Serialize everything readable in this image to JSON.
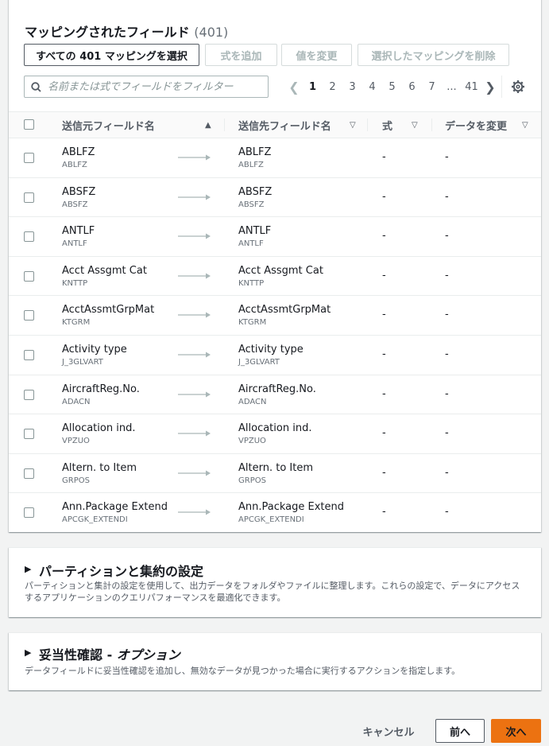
{
  "mapping": {
    "title": "マッピングされたフィールド",
    "count": "(401)",
    "buttons": {
      "select_all": "すべての 401 マッピングを選択",
      "add_formula": "式を追加",
      "change_value": "値を変更",
      "delete_selected": "選択したマッピングを削除"
    },
    "search_placeholder": "名前または式でフィールドをフィルター",
    "pagination": {
      "pages": [
        "1",
        "2",
        "3",
        "4",
        "5",
        "6",
        "7"
      ],
      "ellipsis": "...",
      "last": "41",
      "current": "1"
    },
    "columns": {
      "source": "送信元フィールド名",
      "target": "送信先フィールド名",
      "formula": "式",
      "transform": "データを変更"
    },
    "rows": [
      {
        "src_name": "ABLFZ",
        "src_code": "ABLFZ",
        "dst_name": "ABLFZ",
        "dst_code": "ABLFZ",
        "formula": "-",
        "transform": "-"
      },
      {
        "src_name": "ABSFZ",
        "src_code": "ABSFZ",
        "dst_name": "ABSFZ",
        "dst_code": "ABSFZ",
        "formula": "-",
        "transform": "-"
      },
      {
        "src_name": "ANTLF",
        "src_code": "ANTLF",
        "dst_name": "ANTLF",
        "dst_code": "ANTLF",
        "formula": "-",
        "transform": "-"
      },
      {
        "src_name": "Acct Assgmt Cat",
        "src_code": "KNTTP",
        "dst_name": "Acct Assgmt Cat",
        "dst_code": "KNTTP",
        "formula": "-",
        "transform": "-"
      },
      {
        "src_name": "AcctAssmtGrpMat",
        "src_code": "KTGRM",
        "dst_name": "AcctAssmtGrpMat",
        "dst_code": "KTGRM",
        "formula": "-",
        "transform": "-"
      },
      {
        "src_name": "Activity type",
        "src_code": "J_3GLVART",
        "dst_name": "Activity type",
        "dst_code": "J_3GLVART",
        "formula": "-",
        "transform": "-"
      },
      {
        "src_name": "AircraftReg.No.",
        "src_code": "ADACN",
        "dst_name": "AircraftReg.No.",
        "dst_code": "ADACN",
        "formula": "-",
        "transform": "-"
      },
      {
        "src_name": "Allocation ind.",
        "src_code": "VPZUO",
        "dst_name": "Allocation ind.",
        "dst_code": "VPZUO",
        "formula": "-",
        "transform": "-"
      },
      {
        "src_name": "Altern. to Item",
        "src_code": "GRPOS",
        "dst_name": "Altern. to Item",
        "dst_code": "GRPOS",
        "formula": "-",
        "transform": "-"
      },
      {
        "src_name": "Ann.Package Extend",
        "src_code": "APCGK_EXTENDI",
        "dst_name": "Ann.Package Extend",
        "dst_code": "APCGK_EXTENDI",
        "formula": "-",
        "transform": "-"
      }
    ]
  },
  "partition": {
    "title": "パーティションと集約の設定",
    "description": "パーティションと集計の設定を使用して、出力データをフォルダやファイルに整理します。これらの設定で、データにアクセスするアプリケーションのクエリパフォーマンスを最適化できます。"
  },
  "validation": {
    "title": "妥当性確認 - ",
    "title_option": "オプション",
    "description": "データフィールドに妥当性確認を追加し、無効なデータが見つかった場合に実行するアクションを指定します。"
  },
  "footer": {
    "cancel": "キャンセル",
    "previous": "前へ",
    "next": "次へ"
  },
  "colors": {
    "accent": "#ec7211",
    "text": "#16191f",
    "muted": "#687078",
    "border": "#eaeded"
  }
}
